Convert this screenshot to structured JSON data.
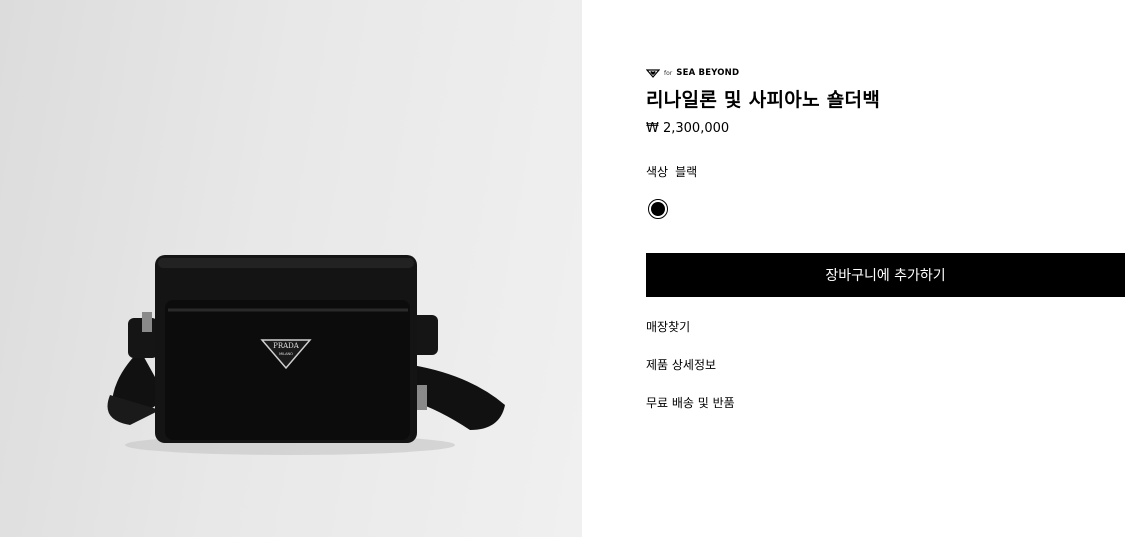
{
  "product_image": {
    "alt": "PRADA nylon and saffiano shoulder bag",
    "logo_text": "PRADA",
    "logo_sub": "MILANO"
  },
  "brand": {
    "prefix": "for",
    "name": "SEA BEYOND",
    "icon": "heart-triangle-icon"
  },
  "product": {
    "title": "리나일론 및 사피아노 숄더백",
    "price": "₩ 2,300,000"
  },
  "color": {
    "label": "색상",
    "value": "블랙",
    "swatch_hex": "#000000"
  },
  "actions": {
    "add_to_cart": "장바구니에 추가하기"
  },
  "links": {
    "store_locator": "매장찾기",
    "product_details": "제품 상세정보",
    "shipping_returns": "무료 배송 및 반품"
  }
}
